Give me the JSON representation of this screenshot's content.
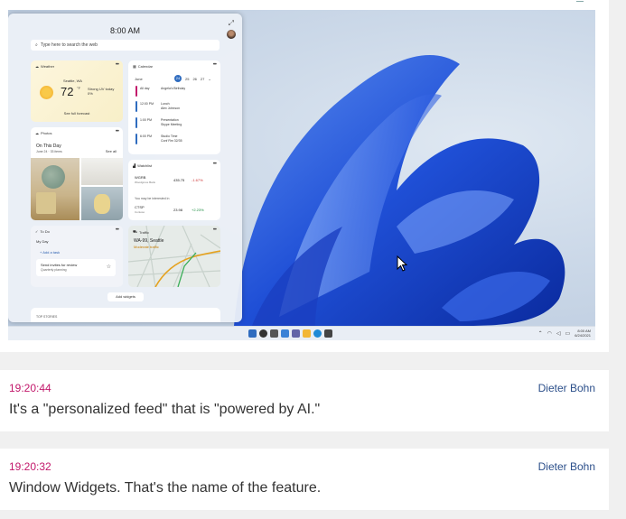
{
  "screenshot": {
    "panel": {
      "time": "8:00 AM",
      "search_placeholder": "Type here to search the web",
      "add_widgets": "Add widgets",
      "top_stories": "TOP STORIES"
    },
    "weather": {
      "title": "Weather",
      "location": "Seattle, WA",
      "temp": "72",
      "unit": "°F",
      "condition_1": "Strong UV today",
      "condition_2": "0%",
      "link": "See full forecast"
    },
    "calendar": {
      "title": "Calendar",
      "month": "June",
      "days": [
        "24",
        "25",
        "26",
        "27"
      ],
      "events": [
        {
          "time": "All day",
          "name": "Angela's Birthday",
          "color": "#c2186b"
        },
        {
          "time": "12:00 PM",
          "name": "Lunch",
          "sub": "Alex Johnson",
          "color": "#2f6cbf"
        },
        {
          "time": "1:00 PM",
          "name": "Presentation",
          "sub": "Skype Meeting",
          "color": "#2f6cbf"
        },
        {
          "time": "6:00 PM",
          "name": "Studio Time",
          "sub": "Conf Rm 32/35",
          "color": "#2f6cbf"
        }
      ]
    },
    "photos": {
      "title": "Photos",
      "heading": "On This Day",
      "date": "June 24 · 33 items",
      "see_all": "See all"
    },
    "watchlist": {
      "title": "Watchlist",
      "stocks": [
        {
          "sym": "WGRB",
          "sub": "Woodgrove Bank",
          "val": "435.75",
          "chg": "-1.67%",
          "dir": "down"
        },
        {
          "sym": "CTSP",
          "sub": "Contoso",
          "val": "23.98",
          "chg": "+2.23%",
          "dir": "up"
        }
      ],
      "note": "You may be interested in"
    },
    "todo": {
      "title": "To Do",
      "list": "My Day",
      "add": "Add a task",
      "item": "Send invites for review",
      "item_sub": "Quarterly planning"
    },
    "traffic": {
      "title": "Traffic",
      "road": "WA-99, Seattle",
      "status": "Moderate traffic"
    },
    "taskbar": {
      "time": "8:00 AM",
      "date": "6/24/2021"
    }
  },
  "posts": [
    {
      "time": "19:20:44",
      "author": "Dieter Bohn",
      "text": "It's a \"personalized feed\" that is \"powered by AI.\""
    },
    {
      "time": "19:20:32",
      "author": "Dieter Bohn",
      "text": "Window Widgets. That's the name of the feature."
    }
  ],
  "colors": {
    "timestamp": "#c2186b",
    "author": "#2c4f8a",
    "accent": "#2f6cbf"
  }
}
